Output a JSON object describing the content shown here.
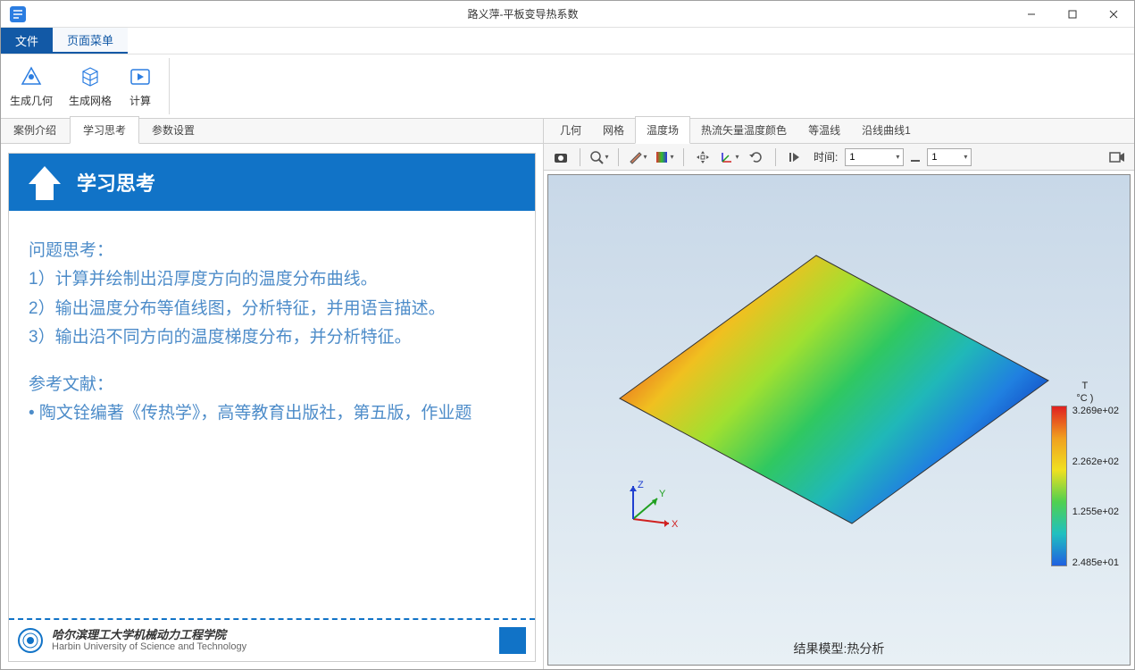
{
  "window": {
    "title": "路义萍-平板变导热系数"
  },
  "menus": {
    "file": "文件",
    "page": "页面菜单"
  },
  "ribbon": {
    "geometry": "生成几何",
    "mesh": "生成网格",
    "compute": "计算"
  },
  "left_tabs": {
    "intro": "案例介绍",
    "study": "学习思考",
    "params": "参数设置"
  },
  "slide": {
    "title": "学习思考",
    "sec1": "问题思考：",
    "l1": "1）计算并绘制出沿厚度方向的温度分布曲线。",
    "l2": "2）输出温度分布等值线图，分析特征，并用语言描述。",
    "l3": "3）输出沿不同方向的温度梯度分布，并分析特征。",
    "ref_title": "参考文献：",
    "ref1": "•  陶文铨编著《传热学》，高等教育出版社，第五版，作业题",
    "footer_cn": "哈尔滨理工大学机械动力工程学院",
    "footer_en": "Harbin University of Science and Technology"
  },
  "viewer_tabs": {
    "geom": "几何",
    "mesh": "网格",
    "temp": "温度场",
    "flux": "热流矢量温度颜色",
    "iso": "等温线",
    "along": "沿线曲线1"
  },
  "toolbar": {
    "time_label": "时间:",
    "time_sel": "1",
    "frame_sel": "1"
  },
  "legend": {
    "title_t": "T",
    "title_unit": "°C )",
    "t0": "3.269e+02",
    "t1": "2.262e+02",
    "t2": "1.255e+02",
    "t3": "2.485e+01"
  },
  "caption": "结果模型:热分析",
  "chart_data": {
    "type": "heatmap",
    "title": "结果模型:热分析",
    "variable": "T (°C)",
    "range": [
      24.85,
      326.9
    ],
    "colorbar_ticks": [
      326.9,
      226.2,
      125.5,
      24.85
    ],
    "description": "Temperature field on a flat plate; gradient varies along diagonal from ~326.9°C (red, upper-left) to ~24.85°C (blue, lower-right)."
  }
}
